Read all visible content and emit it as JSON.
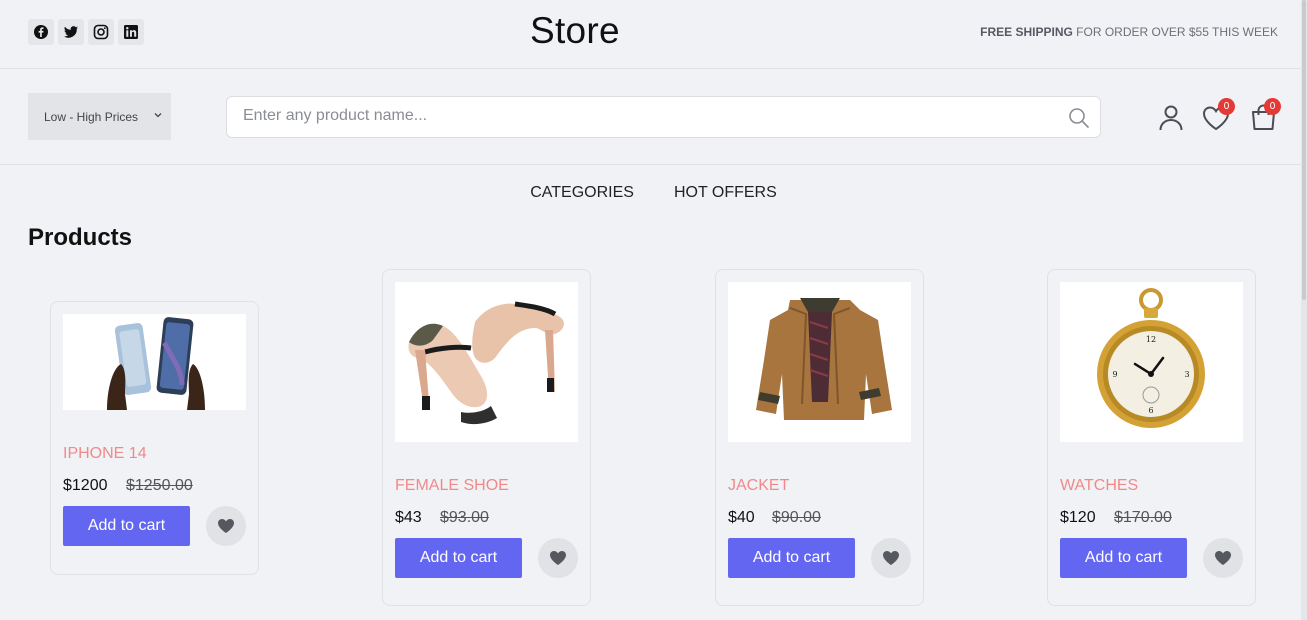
{
  "header": {
    "brand": "Store",
    "promo_bold": "FREE SHIPPING",
    "promo_rest": " FOR ORDER OVER $55 THIS WEEK",
    "socials": [
      "facebook-icon",
      "twitter-icon",
      "instagram-icon",
      "linkedin-icon"
    ]
  },
  "toolbar": {
    "sort_value": "Low - High Prices",
    "search_placeholder": "Enter any product name...",
    "wishlist_count": "0",
    "cart_count": "0"
  },
  "nav": {
    "items": [
      "CATEGORIES",
      "HOT OFFERS"
    ]
  },
  "main": {
    "title": "Products",
    "add_label": "Add to cart",
    "products": [
      {
        "name": "IPHONE 14",
        "price": "$1200",
        "old_price": "$1250.00",
        "image": "smartphone"
      },
      {
        "name": "FEMALE SHOE",
        "price": "$43",
        "old_price": "$93.00",
        "image": "high-heel-shoe"
      },
      {
        "name": "JACKET",
        "price": "$40",
        "old_price": "$90.00",
        "image": "jacket"
      },
      {
        "name": "WATCHES",
        "price": "$120",
        "old_price": "$170.00",
        "image": "pocket-watch"
      }
    ]
  },
  "colors": {
    "accent": "#6366f1",
    "product_name": "#f08a8a",
    "badge": "#e53935",
    "background": "#f1f2f5"
  }
}
